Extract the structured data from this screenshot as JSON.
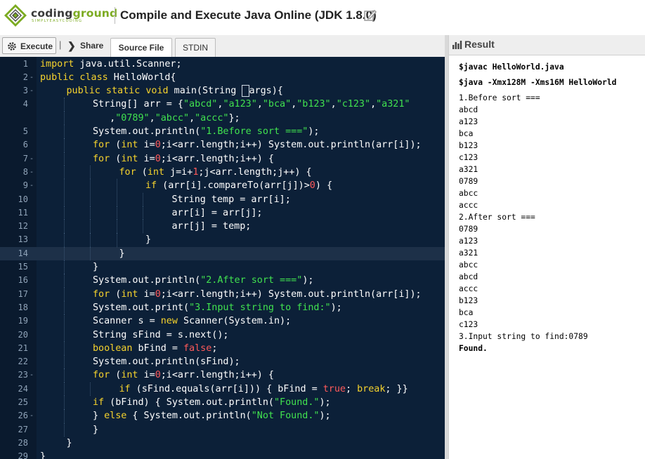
{
  "header": {
    "logo_word_a": "coding",
    "logo_word_b": "ground",
    "logo_tagline": "SIMPLYEASYCODING",
    "title": "Compile and Execute Java Online (JDK 1.8.0)"
  },
  "toolbar": {
    "execute_label": "Execute",
    "divider": "|",
    "share_label": "Share",
    "tabs": [
      "Source File",
      "STDIN"
    ],
    "active_tab": "Source File"
  },
  "colors": {
    "editor_bg": "#0c2038",
    "keyword": "#f6d32d",
    "string": "#41e24f",
    "number": "#ff5a5a",
    "brand": "#7cab21"
  },
  "editor": {
    "active_line": 14,
    "lines": [
      {
        "n": "1",
        "fold": "",
        "indent": 0,
        "tokens": [
          [
            "kw",
            "import"
          ],
          [
            "t",
            " java.util.Scanner;"
          ]
        ]
      },
      {
        "n": "2",
        "fold": "-",
        "indent": 0,
        "tokens": [
          [
            "kw",
            "public class"
          ],
          [
            "t",
            " HelloWorld{"
          ]
        ]
      },
      {
        "n": "3",
        "fold": "-",
        "indent": 1,
        "tokens": [
          [
            "kw",
            "public static void"
          ],
          [
            "t",
            " main(String "
          ],
          [
            "box",
            " "
          ],
          [
            "t",
            "args){"
          ]
        ]
      },
      {
        "n": "4",
        "fold": "",
        "indent": 2,
        "tokens": [
          [
            "t",
            "String[] arr = {"
          ],
          [
            "str",
            "\"abcd\""
          ],
          [
            "t",
            ","
          ],
          [
            "str",
            "\"a123\""
          ],
          [
            "t",
            ","
          ],
          [
            "str",
            "\"bca\""
          ],
          [
            "t",
            ","
          ],
          [
            "str",
            "\"b123\""
          ],
          [
            "t",
            ","
          ],
          [
            "str",
            "\"c123\""
          ],
          [
            "t",
            ","
          ],
          [
            "str",
            "\"a321\""
          ]
        ]
      },
      {
        "n": "",
        "fold": "",
        "indent": 2,
        "tokens": [
          [
            "t",
            "   ,"
          ],
          [
            "str",
            "\"0789\""
          ],
          [
            "t",
            ","
          ],
          [
            "str",
            "\"abcc\""
          ],
          [
            "t",
            ","
          ],
          [
            "str",
            "\"accc\""
          ],
          [
            "t",
            "};"
          ]
        ]
      },
      {
        "n": "5",
        "fold": "",
        "indent": 2,
        "tokens": [
          [
            "t",
            "System.out.println("
          ],
          [
            "str",
            "\"1.Before sort ===\""
          ],
          [
            "t",
            ");"
          ]
        ]
      },
      {
        "n": "6",
        "fold": "",
        "indent": 2,
        "tokens": [
          [
            "kw",
            "for"
          ],
          [
            "t",
            " ("
          ],
          [
            "kw",
            "int"
          ],
          [
            "t",
            " i="
          ],
          [
            "num",
            "0"
          ],
          [
            "t",
            ";i<arr.length;i++) System.out.println(arr[i]);"
          ]
        ]
      },
      {
        "n": "7",
        "fold": "-",
        "indent": 2,
        "tokens": [
          [
            "kw",
            "for"
          ],
          [
            "t",
            " ("
          ],
          [
            "kw",
            "int"
          ],
          [
            "t",
            " i="
          ],
          [
            "num",
            "0"
          ],
          [
            "t",
            ";i<arr.length;i++) {"
          ]
        ]
      },
      {
        "n": "8",
        "fold": "-",
        "indent": 3,
        "tokens": [
          [
            "kw",
            "for"
          ],
          [
            "t",
            " ("
          ],
          [
            "kw",
            "int"
          ],
          [
            "t",
            " j=i+"
          ],
          [
            "num",
            "1"
          ],
          [
            "t",
            ";j<arr.length;j++) {"
          ]
        ]
      },
      {
        "n": "9",
        "fold": "-",
        "indent": 4,
        "tokens": [
          [
            "kw",
            "if"
          ],
          [
            "t",
            " (arr[i].compareTo(arr[j])>"
          ],
          [
            "num",
            "0"
          ],
          [
            "t",
            ") {"
          ]
        ]
      },
      {
        "n": "10",
        "fold": "",
        "indent": 5,
        "tokens": [
          [
            "t",
            "String temp = arr[i];"
          ]
        ]
      },
      {
        "n": "11",
        "fold": "",
        "indent": 5,
        "tokens": [
          [
            "t",
            "arr[i] = arr[j];"
          ]
        ]
      },
      {
        "n": "12",
        "fold": "",
        "indent": 5,
        "tokens": [
          [
            "t",
            "arr[j] = temp;"
          ]
        ]
      },
      {
        "n": "13",
        "fold": "",
        "indent": 4,
        "tokens": [
          [
            "t",
            "}"
          ]
        ]
      },
      {
        "n": "14",
        "fold": "",
        "indent": 3,
        "tokens": [
          [
            "t",
            "}"
          ]
        ]
      },
      {
        "n": "15",
        "fold": "",
        "indent": 2,
        "tokens": [
          [
            "t",
            "}"
          ]
        ]
      },
      {
        "n": "16",
        "fold": "",
        "indent": 2,
        "tokens": [
          [
            "t",
            "System.out.println("
          ],
          [
            "str",
            "\"2.After sort ===\""
          ],
          [
            "t",
            ");"
          ]
        ]
      },
      {
        "n": "17",
        "fold": "",
        "indent": 2,
        "tokens": [
          [
            "kw",
            "for"
          ],
          [
            "t",
            " ("
          ],
          [
            "kw",
            "int"
          ],
          [
            "t",
            " i="
          ],
          [
            "num",
            "0"
          ],
          [
            "t",
            ";i<arr.length;i++) System.out.println(arr[i]);"
          ]
        ]
      },
      {
        "n": "18",
        "fold": "",
        "indent": 2,
        "tokens": [
          [
            "t",
            "System.out.print("
          ],
          [
            "str",
            "\"3.Input string to find:\""
          ],
          [
            "t",
            ");"
          ]
        ]
      },
      {
        "n": "19",
        "fold": "",
        "indent": 2,
        "tokens": [
          [
            "t",
            "Scanner s = "
          ],
          [
            "kw",
            "new"
          ],
          [
            "t",
            " Scanner(System.in);"
          ]
        ]
      },
      {
        "n": "20",
        "fold": "",
        "indent": 2,
        "tokens": [
          [
            "t",
            "String sFind = s.next();"
          ]
        ]
      },
      {
        "n": "21",
        "fold": "",
        "indent": 2,
        "tokens": [
          [
            "kw",
            "boolean"
          ],
          [
            "t",
            " bFind = "
          ],
          [
            "num",
            "false"
          ],
          [
            "t",
            ";"
          ]
        ]
      },
      {
        "n": "22",
        "fold": "",
        "indent": 2,
        "tokens": [
          [
            "t",
            "System.out.println(sFind);"
          ]
        ]
      },
      {
        "n": "23",
        "fold": "-",
        "indent": 2,
        "tokens": [
          [
            "kw",
            "for"
          ],
          [
            "t",
            " ("
          ],
          [
            "kw",
            "int"
          ],
          [
            "t",
            " i="
          ],
          [
            "num",
            "0"
          ],
          [
            "t",
            ";i<arr.length;i++) {"
          ]
        ]
      },
      {
        "n": "24",
        "fold": "",
        "indent": 3,
        "tokens": [
          [
            "kw",
            "if"
          ],
          [
            "t",
            " (sFind.equals(arr[i])) { bFind = "
          ],
          [
            "num",
            "true"
          ],
          [
            "t",
            "; "
          ],
          [
            "kw",
            "break"
          ],
          [
            "t",
            "; }}"
          ]
        ]
      },
      {
        "n": "25",
        "fold": "",
        "indent": 2,
        "tokens": [
          [
            "kw",
            "if"
          ],
          [
            "t",
            " (bFind) { System.out.println("
          ],
          [
            "str",
            "\"Found.\""
          ],
          [
            "t",
            ");"
          ]
        ]
      },
      {
        "n": "26",
        "fold": "-",
        "indent": 2,
        "tokens": [
          [
            "t",
            "} "
          ],
          [
            "kw",
            "else"
          ],
          [
            "t",
            " { System.out.println("
          ],
          [
            "str",
            "\"Not Found.\""
          ],
          [
            "t",
            ");"
          ]
        ]
      },
      {
        "n": "27",
        "fold": "",
        "indent": 2,
        "tokens": [
          [
            "t",
            "}"
          ]
        ]
      },
      {
        "n": "28",
        "fold": "",
        "indent": 1,
        "tokens": [
          [
            "t",
            "}"
          ]
        ]
      },
      {
        "n": "29",
        "fold": "",
        "indent": 0,
        "tokens": [
          [
            "t",
            "}"
          ]
        ]
      }
    ]
  },
  "result": {
    "title": "Result",
    "commands": [
      "$javac HelloWorld.java",
      "$java -Xmx128M -Xms16M HelloWorld"
    ],
    "output": [
      "1.Before sort ===",
      "abcd",
      "a123",
      "bca",
      "b123",
      "c123",
      "a321",
      "0789",
      "abcc",
      "accc",
      "2.After sort ===",
      "0789",
      "a123",
      "a321",
      "abcc",
      "abcd",
      "accc",
      "b123",
      "bca",
      "c123",
      "3.Input string to find:0789",
      "Found."
    ]
  }
}
